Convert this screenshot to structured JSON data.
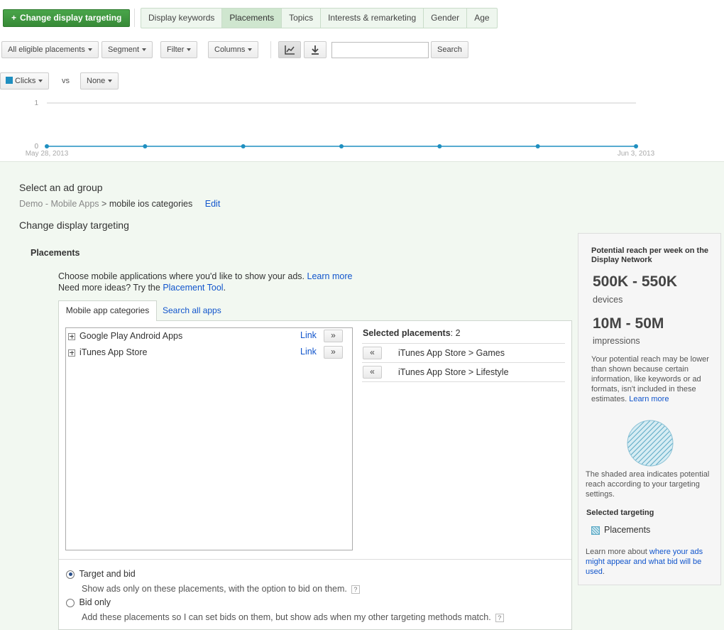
{
  "toolbar": {
    "primary_button": "Change display targeting",
    "tabs": [
      "Display keywords",
      "Placements",
      "Topics",
      "Interests & remarketing",
      "Gender",
      "Age"
    ],
    "active_tab": "Placements",
    "filter_dropdown": "All eligible placements",
    "segment": "Segment",
    "filter": "Filter",
    "columns": "Columns",
    "search_value": "",
    "search_button": "Search"
  },
  "chart_controls": {
    "metric1": "Clicks",
    "vs": "vs",
    "metric2": "None",
    "metric1_color": "#1f8fc0"
  },
  "chart_data": {
    "type": "line",
    "x": [
      "May 28, 2013",
      "May 29, 2013",
      "May 30, 2013",
      "May 31, 2013",
      "Jun 1, 2013",
      "Jun 2, 2013",
      "Jun 3, 2013"
    ],
    "x_tick_labels": [
      "May 28, 2013",
      "Jun 3, 2013"
    ],
    "series": [
      {
        "name": "Clicks",
        "values": [
          0,
          0,
          0,
          0,
          0,
          0,
          0
        ],
        "color": "#1f8fc0"
      }
    ],
    "ylim": [
      0,
      1
    ],
    "y_ticks": [
      "0",
      "1"
    ],
    "grid": true
  },
  "main": {
    "select_ad_group": "Select an ad group",
    "breadcrumb_campaign": "Demo - Mobile Apps",
    "breadcrumb_separator": ">",
    "breadcrumb_adgroup": "mobile ios categories",
    "edit_link": "Edit",
    "change_heading": "Change display targeting",
    "placements_heading": "Placements",
    "intro_line1": "Choose mobile applications where you'd like to show your ads.",
    "learn_more": "Learn more",
    "intro_line2": "Need more ideas? Try the",
    "placement_tool": "Placement Tool",
    "intro_line2_end": ".",
    "tab_categories": "Mobile app categories",
    "tab_search": "Search all apps",
    "categories": [
      {
        "label": "Google Play Android Apps",
        "link": "Link",
        "add": "»"
      },
      {
        "label": "iTunes App Store",
        "link": "Link",
        "add": "»"
      }
    ],
    "selected_label": "Selected placements",
    "selected_count": ": 2",
    "selected": [
      {
        "remove": "«",
        "label": "iTunes App Store > Games"
      },
      {
        "remove": "«",
        "label": "iTunes App Store > Lifestyle"
      }
    ],
    "option1_label": "Target and bid",
    "option1_desc": "Show ads only on these placements, with the option to bid on them.",
    "option2_label": "Bid only",
    "option2_desc": "Add these placements so I can set bids on them, but show ads when my other targeting methods match.",
    "help_glyph": "?"
  },
  "reach": {
    "title": "Potential reach per week on the Display Network",
    "devices_value": "500K - 550K",
    "devices_label": "devices",
    "impressions_value": "10M - 50M",
    "impressions_label": "impressions",
    "note": "Your potential reach may be lower than shown because certain information, like keywords or ad formats, isn't included in these estimates.",
    "note_link": "Learn more",
    "shaded_note": "The shaded area indicates potential reach according to your targeting settings.",
    "selected_targeting": "Selected targeting",
    "legend_item": "Placements",
    "footer_text": "Learn more about",
    "footer_link": "where your ads might appear and what bid will be used",
    "footer_end": "."
  }
}
